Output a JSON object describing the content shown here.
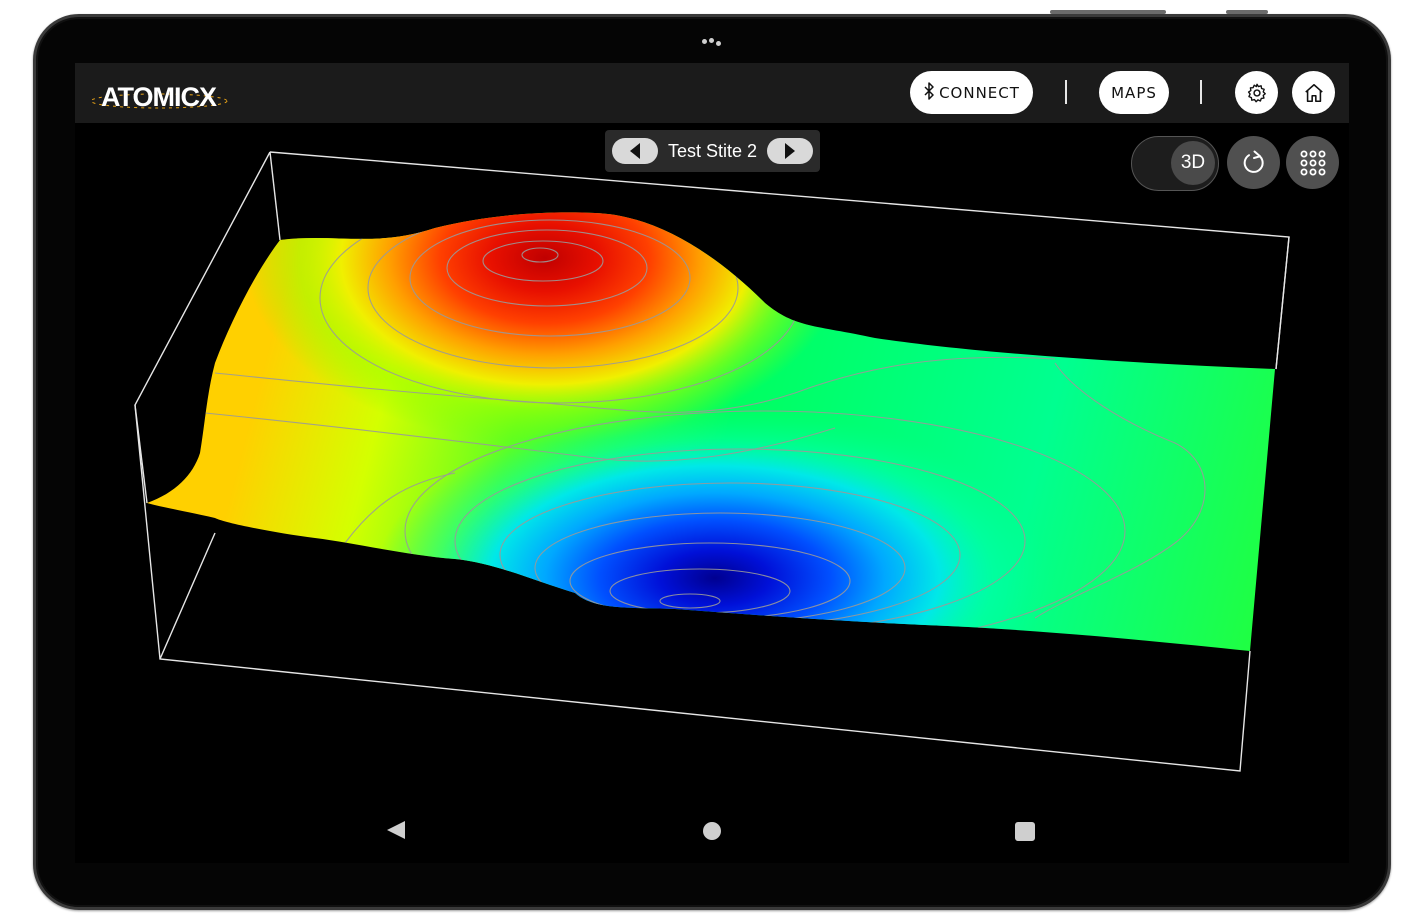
{
  "app": {
    "logo_text": "ATOMICX",
    "brand_color": "#e8a317"
  },
  "header": {
    "connect_label": "CONNECT",
    "maps_label": "MAPS",
    "icons": {
      "connect": "bluetooth-icon",
      "settings": "gear-icon",
      "home": "home-icon"
    }
  },
  "site_selector": {
    "site_name": "Test Stite 2",
    "prev_icon": "triangle-left-icon",
    "next_icon": "triangle-right-icon"
  },
  "view_controls": {
    "mode_label": "3D",
    "rotate_icon": "refresh-icon",
    "menu_icon": "grid-dots-icon"
  },
  "surface": {
    "type": "3d-surface-with-contours",
    "colormap": [
      "#0000c8",
      "#0060ff",
      "#00d0ff",
      "#00ff90",
      "#30ff30",
      "#c0ff00",
      "#ffe000",
      "#ff7000",
      "#f01000",
      "#c00000"
    ],
    "features": [
      "peak-high (red)",
      "depression-low (blue)"
    ],
    "contour_color": "#9a9a9a"
  },
  "system_nav": {
    "back_icon": "back-triangle-icon",
    "home_icon": "circle-home-icon",
    "recents_icon": "square-recents-icon"
  }
}
